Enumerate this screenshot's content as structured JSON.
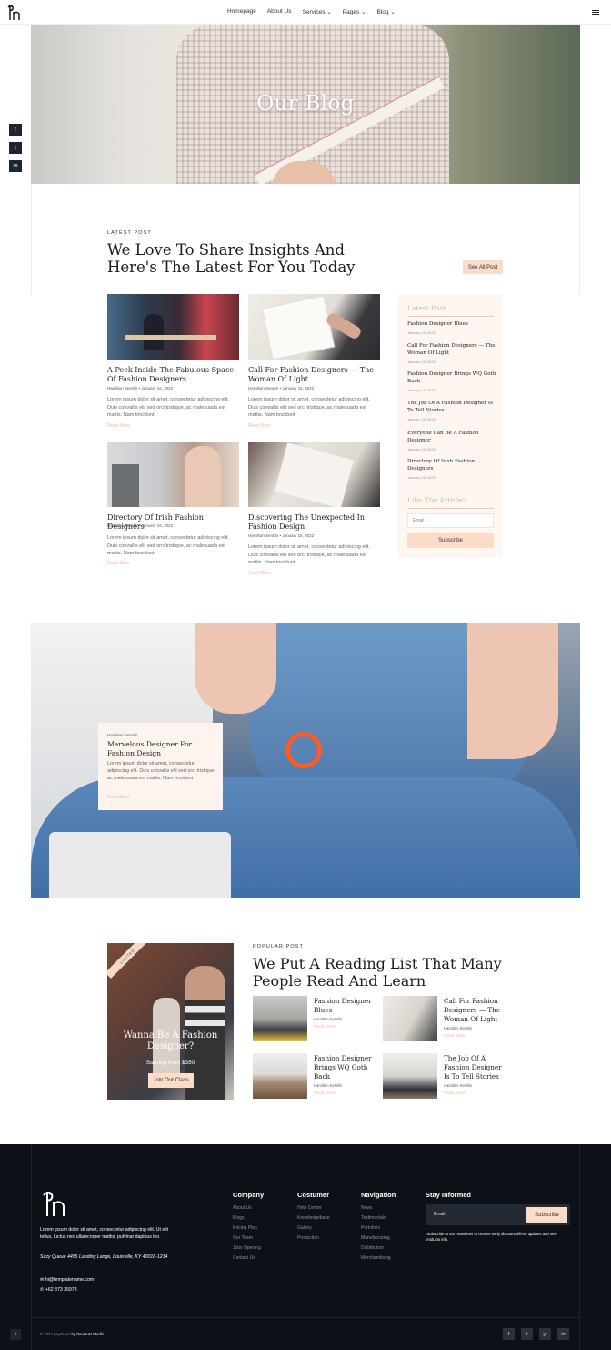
{
  "header": {
    "nav": [
      "Homepage",
      "About Us",
      "Services",
      "Pages",
      "Blog"
    ]
  },
  "social_side": [
    "f",
    "t",
    "in"
  ],
  "hero": {
    "title": "Our Blog"
  },
  "latest": {
    "eyebrow": "LATEST POST",
    "title_line1": "We Love To Share Insights And",
    "title_line2": "Here's The Latest For You Today",
    "see_all": "See All Post"
  },
  "cards": [
    {
      "title": "A Peek Inside The Fabulous Space Of Fashion Designers",
      "meta": "Hamilton Serafin • January 16, 2022",
      "excerpt": "Lorem ipsum dolor sit amet, consectetur adipiscing elit. Duis convallis elit sed orci tristique, ac malesuada est mattis. Nam tincidunt",
      "read": "Read More"
    },
    {
      "title": "Call For Fashion Designers — The Woman Of Light",
      "meta": "Hamilton Serafin • January 16, 2022",
      "excerpt": "Lorem ipsum dolor sit amet, consectetur adipiscing elit. Duis convallis elit sed orci tristique, ac malesuada est mattis. Nam tincidunt",
      "read": "Read More"
    },
    {
      "title": "Directory Of Irish Fashion Designers",
      "meta": "Hamilton Serafin • January 16, 2022",
      "excerpt": "Lorem ipsum dolor sit amet, consectetur adipiscing elit. Duis convallis elit sed orci tristique, ac malesuada est mattis. Nam tincidunt",
      "read": "Read More"
    },
    {
      "title": "Discovering The Unexpected In Fashion Design",
      "meta": "Hamilton Serafin • January 16, 2022",
      "excerpt": "Lorem ipsum dolor sit amet, consectetur adipiscing elit. Duis convallis elit sed orci tristique, ac malesuada est mattis. Nam tincidunt",
      "read": "Read More"
    }
  ],
  "sidebar": {
    "heading": "Latest Post",
    "items": [
      {
        "title": "Fashion Designer Blues",
        "date": "January 16, 2022"
      },
      {
        "title": "Call For Fashion Designers — The Woman Of Light",
        "date": "January 16, 2022"
      },
      {
        "title": "Fashion Designer Brings WQ Goth Back",
        "date": "January 16, 2022"
      },
      {
        "title": "The Job Of A Fashion Designer Is To Tell Stories",
        "date": "January 16, 2022"
      },
      {
        "title": "Everyone Can Be A Fashion Designer",
        "date": "January 16, 2022"
      },
      {
        "title": "Directory Of Irish Fashion Designers",
        "date": "January 16, 2022"
      }
    ],
    "like_heading": "Like The Article?",
    "email_placeholder": "Email",
    "subscribe": "Subscribe"
  },
  "banner": {
    "author": "Hamilton Serafin",
    "title": "Marvelous Designer For Fashion Design",
    "excerpt": "Lorem ipsum dolor sit amet, consectetur adipiscing elit. Duis convallis elit sed orci tristique, ac malesuada est mattis. Nam tincidunt",
    "read": "Read More"
  },
  "popular": {
    "eyebrow": "POPULAR POST",
    "title_line1": "We Put A Reading List That Many",
    "title_line2": "People Read And Learn",
    "promo": {
      "ribbon": "LIMITED",
      "title": "Wanna Be A Fashion Designer?",
      "price": "Starting from $350",
      "button": "Join Our Class"
    },
    "items": [
      {
        "title": "Fashion Designer Blues",
        "author": "Hamilton Serafin",
        "read": "Read More"
      },
      {
        "title": "Call For Fashion Designers — The Woman Of Light",
        "author": "Hamilton Serafin",
        "read": "Read More"
      },
      {
        "title": "Fashion Designer Brings WQ Goth Back",
        "author": "Hamilton Serafin",
        "read": "Read More"
      },
      {
        "title": "The Job Of A Fashion Designer Is To Tell Stories",
        "author": "Hamilton Serafin",
        "read": "Read More"
      }
    ]
  },
  "footer": {
    "about": "Lorem ipsum dolor sit amet, consectetur adipiscing elit. Ut elit tellus, luctus nec ullamcorper mattis, pulvinar dapibus leo.",
    "address": "Suzy Queue 4455 Landing Lange, Louisville, KY 40018-1234",
    "email": "hi@templatename.com",
    "phone": "+62 873 35973",
    "company": {
      "heading": "Company",
      "links": [
        "About Us",
        "Blogs",
        "Pricing Plan",
        "Our Team",
        "Jobs Opening",
        "Contact Us"
      ]
    },
    "costumer": {
      "heading": "Costumer",
      "links": [
        "Help Center",
        "Knowledgebase",
        "Gallery",
        "Production"
      ]
    },
    "navigation": {
      "heading": "Navigation",
      "links": [
        "News",
        "Testimonials",
        "Portofolio",
        "Manufacturing",
        "Distribution",
        "Merchandising"
      ]
    },
    "newsletter": {
      "heading": "Stay Informed",
      "email_placeholder": "Email",
      "button": "Subscribe",
      "note": "*Subscribe to our newsletter to receive early discount offers, updates and new products info."
    },
    "copyright": "© 2022 Keyshana",
    "credit": "by Deverust Studio",
    "social": [
      "f",
      "t",
      "yt",
      "in"
    ]
  },
  "colors": {
    "accent": "#fbdcc9",
    "accent_text": "#f0b89a",
    "footer_bg": "#0d1117"
  }
}
